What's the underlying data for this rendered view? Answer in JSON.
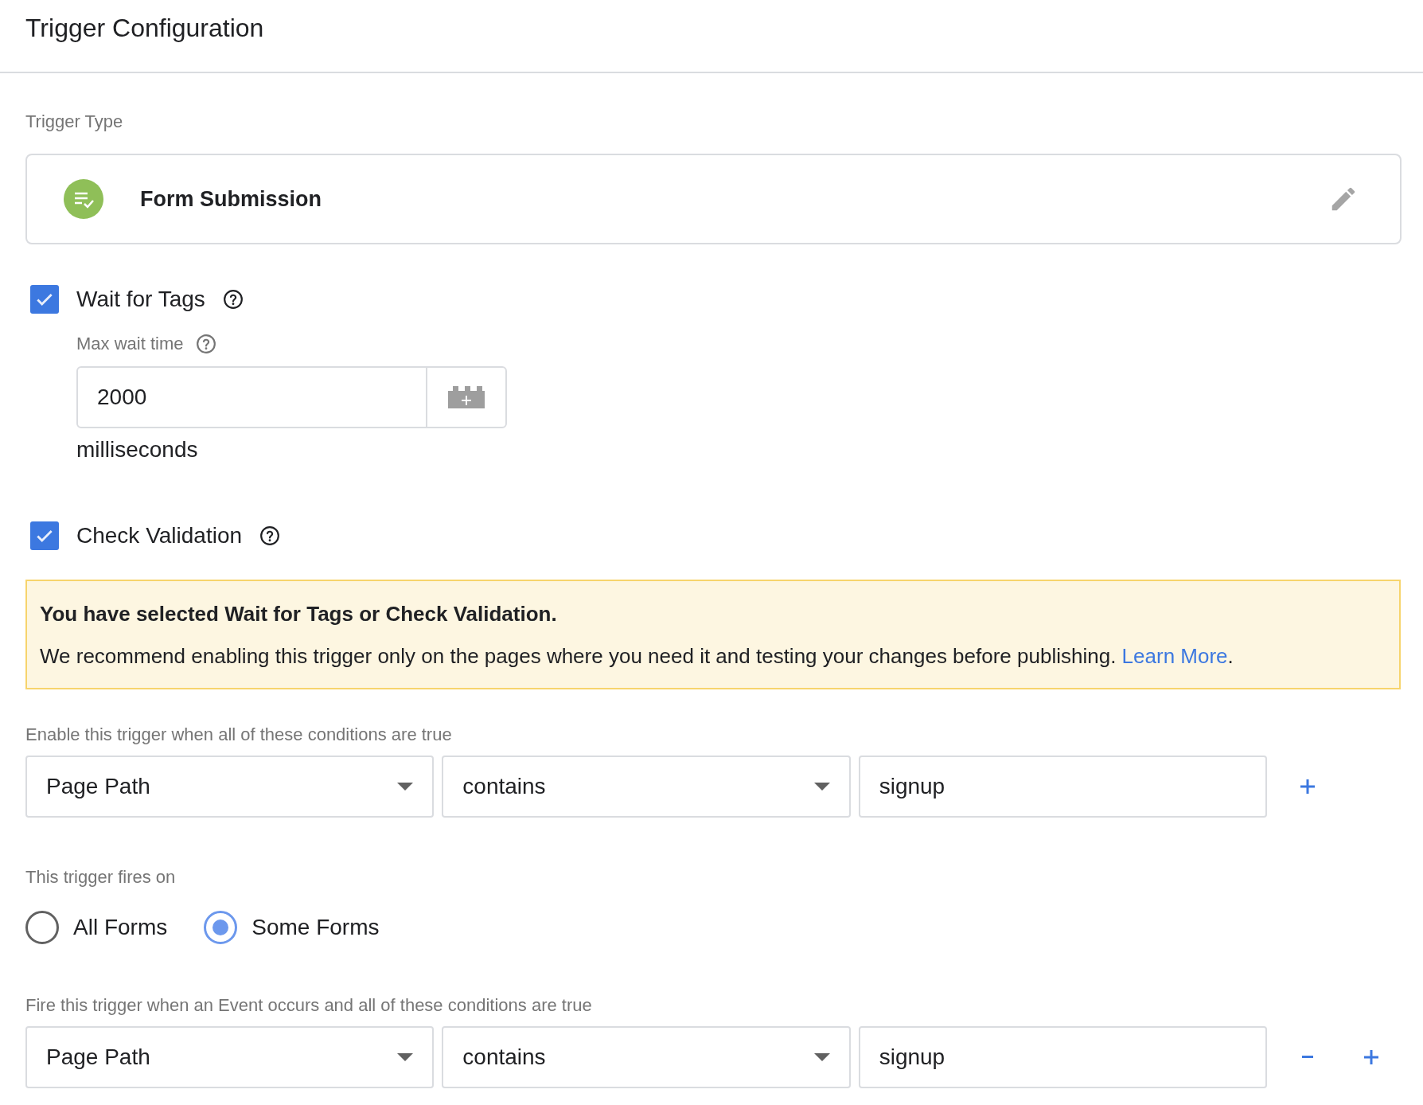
{
  "title": "Trigger Configuration",
  "trigger_type": {
    "label": "Trigger Type",
    "name": "Form Submission"
  },
  "options": [
    {
      "label": "Wait for Tags",
      "checked": true,
      "max_wait": {
        "label": "Max wait time",
        "value": "2000",
        "unit": "milliseconds"
      }
    },
    {
      "label": "Check Validation",
      "checked": true
    }
  ],
  "banner": {
    "title": "You have selected Wait for Tags or Check Validation.",
    "text": "We recommend enabling this trigger only on the pages where you need it and testing your changes before publishing.",
    "link": "Learn More",
    "suffix": "."
  },
  "enable_conditions": {
    "label": "Enable this trigger when all of these conditions are true",
    "rows": [
      {
        "variable": "Page Path",
        "operator": "contains",
        "value": "signup",
        "removable": false
      }
    ]
  },
  "fires_on": {
    "label": "This trigger fires on",
    "options": [
      {
        "label": "All Forms",
        "selected": false
      },
      {
        "label": "Some Forms",
        "selected": true
      }
    ]
  },
  "fire_conditions": {
    "label": "Fire this trigger when an Event occurs and all of these conditions are true",
    "rows": [
      {
        "variable": "Page Path",
        "operator": "contains",
        "value": "signup",
        "removable": true
      }
    ]
  }
}
